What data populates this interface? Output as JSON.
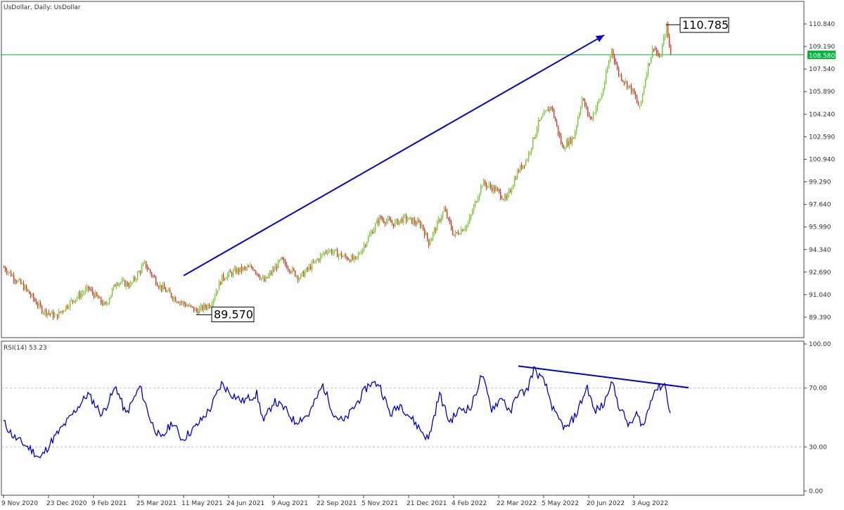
{
  "chart_data": [
    {
      "type": "candlestick",
      "title": "UsDollar, Daily:  UsDollar",
      "yticks": [
        "110.840",
        "109.190",
        "107.540",
        "105.890",
        "104.240",
        "102.590",
        "100.940",
        "99.290",
        "97.640",
        "95.990",
        "94.340",
        "92.690",
        "91.040",
        "89.390"
      ],
      "ylim": [
        88.5,
        111.9
      ],
      "current_price": "108.580",
      "xtick_labels": [
        "9 Nov 2020",
        "23 Dec 2020",
        "9 Feb 2021",
        "25 Mar 2021",
        "11 May 2021",
        "24 Jun 2021",
        "9 Aug 2021",
        "22 Sep 2021",
        "5 Nov 2021",
        "21 Dec 2021",
        "4 Feb 2022",
        "22 Mar 2022",
        "5 May 2022",
        "20 Jun 2022",
        "3 Aug 2022"
      ],
      "bars_per_xtick": 32,
      "close_keypoints": [
        [
          0,
          93.04
        ],
        [
          15,
          91.5
        ],
        [
          27,
          89.95
        ],
        [
          37,
          89.44
        ],
        [
          47,
          90.47
        ],
        [
          60,
          91.5
        ],
        [
          72,
          90.2
        ],
        [
          80,
          92.0
        ],
        [
          90,
          91.76
        ],
        [
          100,
          93.3
        ],
        [
          110,
          91.76
        ],
        [
          122,
          90.73
        ],
        [
          137,
          89.85
        ],
        [
          147,
          90.37
        ],
        [
          155,
          92.27
        ],
        [
          165,
          92.79
        ],
        [
          177,
          93.04
        ],
        [
          185,
          92.0
        ],
        [
          197,
          93.56
        ],
        [
          210,
          92.27
        ],
        [
          220,
          93.3
        ],
        [
          230,
          94.33
        ],
        [
          242,
          93.8
        ],
        [
          250,
          93.56
        ],
        [
          257,
          94.84
        ],
        [
          267,
          96.64
        ],
        [
          277,
          96.23
        ],
        [
          285,
          96.64
        ],
        [
          297,
          96.13
        ],
        [
          302,
          94.84
        ],
        [
          313,
          97.26
        ],
        [
          320,
          95.36
        ],
        [
          330,
          96.23
        ],
        [
          340,
          99.21
        ],
        [
          350,
          98.7
        ],
        [
          357,
          97.93
        ],
        [
          365,
          99.99
        ],
        [
          372,
          101.01
        ],
        [
          380,
          103.59
        ],
        [
          389,
          104.87
        ],
        [
          397,
          101.79
        ],
        [
          405,
          102.56
        ],
        [
          411,
          105.39
        ],
        [
          417,
          103.85
        ],
        [
          425,
          105.64
        ],
        [
          432,
          108.99
        ],
        [
          437,
          107.19
        ],
        [
          447,
          105.9
        ],
        [
          452,
          104.62
        ],
        [
          457,
          107.45
        ],
        [
          462,
          109.25
        ],
        [
          466,
          108.22
        ],
        [
          471,
          110.63
        ],
        [
          474,
          108.58
        ]
      ],
      "annotations": [
        {
          "type": "arrow",
          "from": [
            128,
            92.43
          ],
          "to": [
            427,
            110.02
          ],
          "color": "#0000cc"
        },
        {
          "type": "label",
          "text": "110.785",
          "bar": 471,
          "price": 110.785
        },
        {
          "type": "label",
          "text": "89.570",
          "bar": 137,
          "price": 89.57
        }
      ],
      "colors": {
        "bull": "#6fd02a",
        "bear": "#ea3020",
        "price_line": "#00b43c"
      }
    },
    {
      "type": "line",
      "title": "RSI(14) 53.23",
      "yticks": [
        "100.00",
        "70.00",
        "30.00",
        "0.00"
      ],
      "levels": [
        70,
        30
      ],
      "ylim": [
        0,
        100
      ],
      "rsi_keypoints": [
        [
          0,
          47
        ],
        [
          7,
          37
        ],
        [
          20,
          28
        ],
        [
          26,
          22
        ],
        [
          35,
          35
        ],
        [
          45,
          47
        ],
        [
          52,
          56
        ],
        [
          60,
          66
        ],
        [
          70,
          52
        ],
        [
          80,
          71
        ],
        [
          87,
          52
        ],
        [
          97,
          71
        ],
        [
          105,
          47
        ],
        [
          112,
          35
        ],
        [
          120,
          47
        ],
        [
          127,
          35
        ],
        [
          137,
          44
        ],
        [
          147,
          56
        ],
        [
          155,
          73
        ],
        [
          162,
          66
        ],
        [
          170,
          61
        ],
        [
          180,
          66
        ],
        [
          185,
          47
        ],
        [
          192,
          61
        ],
        [
          200,
          56
        ],
        [
          207,
          47
        ],
        [
          217,
          52
        ],
        [
          227,
          72
        ],
        [
          235,
          52
        ],
        [
          242,
          47
        ],
        [
          252,
          61
        ],
        [
          260,
          73
        ],
        [
          267,
          73
        ],
        [
          275,
          52
        ],
        [
          282,
          59
        ],
        [
          292,
          47
        ],
        [
          302,
          35
        ],
        [
          310,
          66
        ],
        [
          317,
          47
        ],
        [
          325,
          56
        ],
        [
          332,
          56
        ],
        [
          340,
          79
        ],
        [
          347,
          56
        ],
        [
          355,
          64
        ],
        [
          360,
          52
        ],
        [
          365,
          66
        ],
        [
          372,
          68
        ],
        [
          377,
          83
        ],
        [
          385,
          73
        ],
        [
          392,
          52
        ],
        [
          400,
          42
        ],
        [
          407,
          52
        ],
        [
          415,
          71
        ],
        [
          420,
          54
        ],
        [
          427,
          59
        ],
        [
          432,
          76
        ],
        [
          437,
          59
        ],
        [
          445,
          44
        ],
        [
          450,
          52
        ],
        [
          455,
          44
        ],
        [
          462,
          68
        ],
        [
          470,
          73
        ],
        [
          474,
          53
        ]
      ],
      "trendline": {
        "from": [
          366,
          85
        ],
        "to": [
          487,
          70.3
        ],
        "color": "#0000cc"
      },
      "color": "#0000cc"
    }
  ]
}
